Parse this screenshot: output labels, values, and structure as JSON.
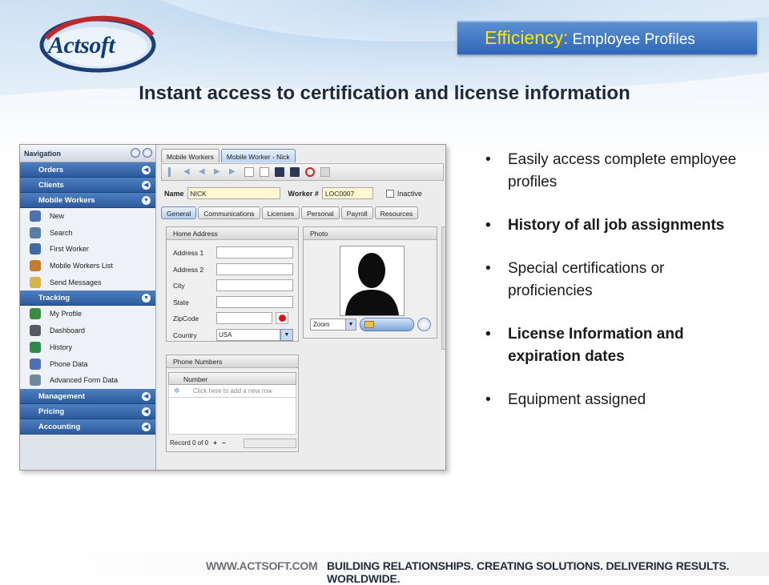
{
  "header": {
    "logo_text": "Actsoft",
    "title_accent": "Efficiency:",
    "title_rest": " Employee Profiles",
    "subtitle": "Instant access to certification and license information"
  },
  "app": {
    "nav": {
      "title": "Navigation",
      "sections_top": [
        {
          "label": "Orders",
          "arrow": "◀"
        },
        {
          "label": "Clients",
          "arrow": "◀"
        },
        {
          "label": "Mobile Workers",
          "arrow": "▼"
        }
      ],
      "mobile_workers_items": [
        {
          "label": "New",
          "icon": "user-add-icon",
          "color": "#4a72b0"
        },
        {
          "label": "Search",
          "icon": "user-search-icon",
          "color": "#5a7da8"
        },
        {
          "label": "First Worker",
          "icon": "user-icon",
          "color": "#3f6aa6"
        },
        {
          "label": "Mobile Workers List",
          "icon": "users-list-icon",
          "color": "#c47d2b"
        },
        {
          "label": "Send Messages",
          "icon": "envelope-icon",
          "color": "#d8b24a"
        }
      ],
      "tracking": {
        "label": "Tracking",
        "arrow": "▼"
      },
      "tracking_items": [
        {
          "label": "My Profile",
          "icon": "profile-icon",
          "color": "#3b8c3f"
        },
        {
          "label": "Dashboard",
          "icon": "dashboard-icon",
          "color": "#555a63"
        },
        {
          "label": "History",
          "icon": "history-icon",
          "color": "#2e8a4b"
        },
        {
          "label": "Phone Data",
          "icon": "phone-icon",
          "color": "#4f6fb5"
        },
        {
          "label": "Advanced Form Data",
          "icon": "form-icon",
          "color": "#6f8a9a"
        }
      ],
      "sections_bottom": [
        {
          "label": "Management",
          "arrow": "◀"
        },
        {
          "label": "Pricing",
          "arrow": "◀"
        },
        {
          "label": "Accounting",
          "arrow": "◀"
        }
      ]
    },
    "top_tabs": [
      "Mobile Workers",
      "Mobile Worker - Nick"
    ],
    "form": {
      "name_label": "Name",
      "name_value": "NICK",
      "worker_label": "Worker #",
      "worker_value": "LOC0007",
      "inactive_label": "Inactive"
    },
    "sub_tabs": [
      "General",
      "Communications",
      "Licenses",
      "Personal",
      "Payroll",
      "Resources"
    ],
    "home_address": {
      "title": "Home Address",
      "fields": [
        {
          "label": "Address 1",
          "value": ""
        },
        {
          "label": "Address 2",
          "value": ""
        },
        {
          "label": "City",
          "value": ""
        },
        {
          "label": "State",
          "value": ""
        },
        {
          "label": "ZipCode",
          "value": ""
        },
        {
          "label": "Country",
          "value": "USA"
        }
      ]
    },
    "photo": {
      "title": "Photo",
      "zoom_value": "Zoom"
    },
    "phone_numbers": {
      "title": "Phone Numbers",
      "column": "Number",
      "add_row": "Click here to add a new row",
      "record_text": "Record 0 of 0"
    }
  },
  "bullets": [
    {
      "text": "Easily access complete employee profiles",
      "bold": false
    },
    {
      "text": "History of all job assignments",
      "bold": true
    },
    {
      "text": "Special certifications or proficiencies",
      "bold": false
    },
    {
      "text": "License Information and expiration dates",
      "bold": true
    },
    {
      "text": "Equipment assigned",
      "bold": false
    }
  ],
  "footer": {
    "website": "WWW.ACTSOFT.COM",
    "tagline": "BUILDING RELATIONSHIPS. CREATING SOLUTIONS. DELIVERING RESULTS. WORLDWIDE."
  }
}
